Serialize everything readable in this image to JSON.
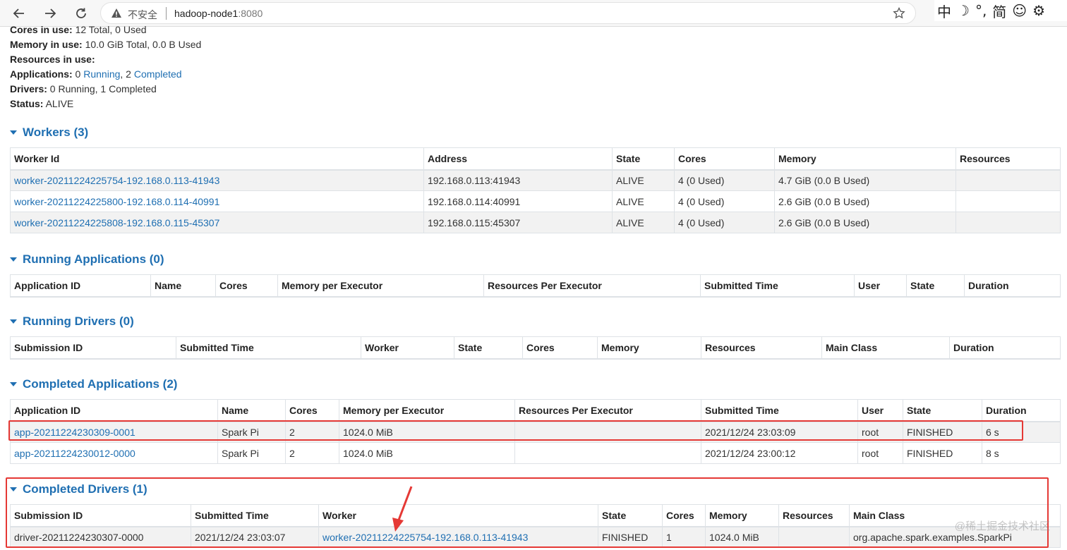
{
  "browser": {
    "insecure_label": "不安全",
    "host": "hadoop-node1",
    "port": ":8080",
    "ime": [
      "中",
      "☽",
      "°,",
      "简",
      "☺",
      "⚙"
    ]
  },
  "summary": {
    "cores_label": "Cores in use:",
    "cores_value": " 12 Total, 0 Used",
    "memory_label": "Memory in use:",
    "memory_value": " 10.0 GiB Total, 0.0 B Used",
    "resources_label": "Resources in use:",
    "apps_label": "Applications:",
    "apps_running_count": " 0 ",
    "apps_running_link": "Running",
    "apps_sep": ", 2 ",
    "apps_completed_link": "Completed",
    "drivers_label": "Drivers:",
    "drivers_value": " 0 Running, 1 Completed",
    "status_label": "Status:",
    "status_value": " ALIVE"
  },
  "workers": {
    "title": "Workers (3)",
    "headers": [
      "Worker Id",
      "Address",
      "State",
      "Cores",
      "Memory",
      "Resources"
    ],
    "rows": [
      [
        "worker-20211224225754-192.168.0.113-41943",
        "192.168.0.113:41943",
        "ALIVE",
        "4 (0 Used)",
        "4.7 GiB (0.0 B Used)",
        ""
      ],
      [
        "worker-20211224225800-192.168.0.114-40991",
        "192.168.0.114:40991",
        "ALIVE",
        "4 (0 Used)",
        "2.6 GiB (0.0 B Used)",
        ""
      ],
      [
        "worker-20211224225808-192.168.0.115-45307",
        "192.168.0.115:45307",
        "ALIVE",
        "4 (0 Used)",
        "2.6 GiB (0.0 B Used)",
        ""
      ]
    ]
  },
  "running_apps": {
    "title": "Running Applications (0)",
    "headers": [
      "Application ID",
      "Name",
      "Cores",
      "Memory per Executor",
      "Resources Per Executor",
      "Submitted Time",
      "User",
      "State",
      "Duration"
    ]
  },
  "running_drivers": {
    "title": "Running Drivers (0)",
    "headers": [
      "Submission ID",
      "Submitted Time",
      "Worker",
      "State",
      "Cores",
      "Memory",
      "Resources",
      "Main Class",
      "Duration"
    ]
  },
  "completed_apps": {
    "title": "Completed Applications (2)",
    "headers": [
      "Application ID",
      "Name",
      "Cores",
      "Memory per Executor",
      "Resources Per Executor",
      "Submitted Time",
      "User",
      "State",
      "Duration"
    ],
    "rows": [
      [
        "app-20211224230309-0001",
        "Spark Pi",
        "2",
        "1024.0 MiB",
        "",
        "2021/12/24 23:03:09",
        "root",
        "FINISHED",
        "6 s"
      ],
      [
        "app-20211224230012-0000",
        "Spark Pi",
        "2",
        "1024.0 MiB",
        "",
        "2021/12/24 23:00:12",
        "root",
        "FINISHED",
        "8 s"
      ]
    ]
  },
  "completed_drivers": {
    "title": "Completed Drivers (1)",
    "headers": [
      "Submission ID",
      "Submitted Time",
      "Worker",
      "State",
      "Cores",
      "Memory",
      "Resources",
      "Main Class"
    ],
    "rows": [
      [
        "driver-20211224230307-0000",
        "2021/12/24 23:03:07",
        "worker-20211224225754-192.168.0.113-41943",
        "FINISHED",
        "1",
        "1024.0 MiB",
        "",
        "org.apache.spark.examples.SparkPi"
      ]
    ]
  },
  "watermark": "@稀土掘金技术社区",
  "colors": {
    "link": "#1f6fb2",
    "highlight": "#e53935",
    "stripe": "#f2f2f2"
  }
}
